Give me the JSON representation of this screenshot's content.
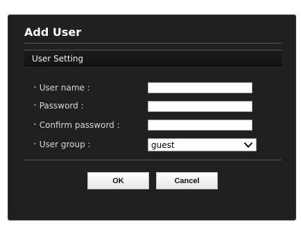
{
  "dialog": {
    "title": "Add User",
    "section_title": "User Setting",
    "fields": [
      {
        "label": "User name :",
        "value": ""
      },
      {
        "label": "Password :",
        "value": ""
      },
      {
        "label": "Confirm password :",
        "value": ""
      }
    ],
    "user_group": {
      "label": "User group :",
      "selected": "guest"
    },
    "buttons": {
      "ok": "OK",
      "cancel": "Cancel"
    }
  }
}
